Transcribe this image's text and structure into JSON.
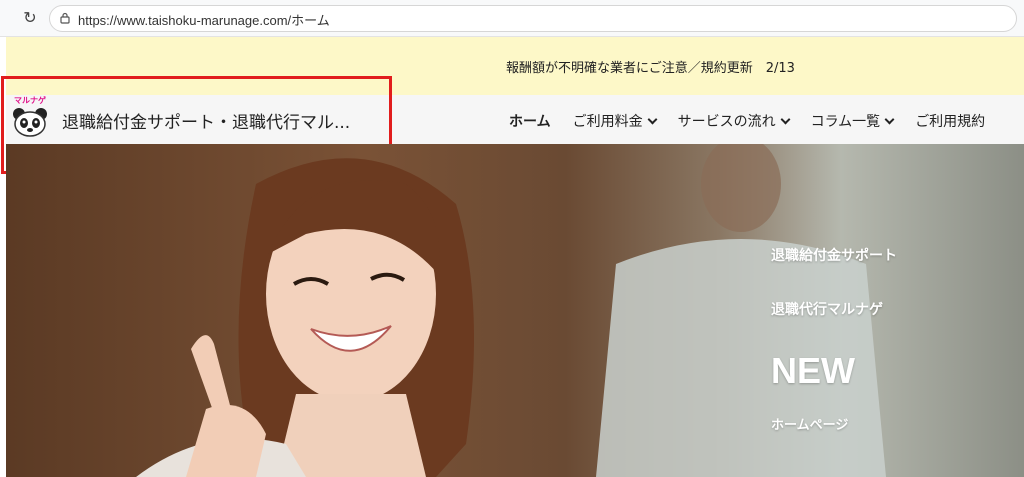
{
  "browser": {
    "url": "https://www.taishoku-marunage.com/ホーム"
  },
  "announcement": {
    "text": "報酬額が不明確な業者にご注意／規約更新　2/13"
  },
  "header": {
    "logo_label": "マルナゲ",
    "site_title": "退職給付金サポート・退職代行マル...",
    "nav": [
      {
        "label": "ホーム",
        "active": true,
        "dropdown": false
      },
      {
        "label": "ご利用料金",
        "active": false,
        "dropdown": true
      },
      {
        "label": "サービスの流れ",
        "active": false,
        "dropdown": true
      },
      {
        "label": "コラム一覧",
        "active": false,
        "dropdown": true
      },
      {
        "label": "ご利用規約",
        "active": false,
        "dropdown": false
      }
    ]
  },
  "hero": {
    "line1": "退職給付金サポート",
    "line2": "退職代行マルナゲ",
    "line3": "NEW",
    "line4": "ホームページ"
  },
  "colors": {
    "announce_bg": "#fdf8c8",
    "highlight": "#e11d1d",
    "logo_accent": "#e0118a"
  }
}
